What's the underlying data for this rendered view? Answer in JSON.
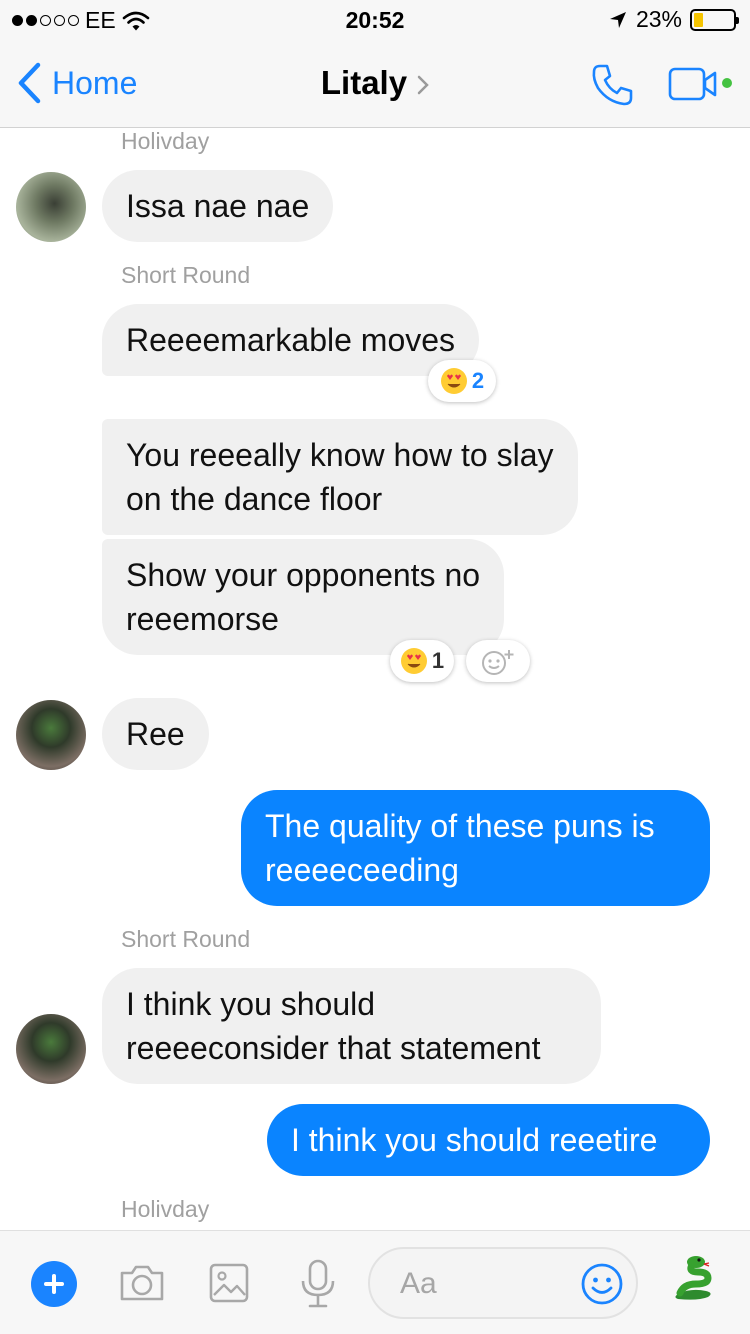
{
  "status_bar": {
    "carrier": "EE",
    "time": "20:52",
    "battery": "23%",
    "battery_level": 0.23
  },
  "nav": {
    "back_label": "Home",
    "title": "Litaly"
  },
  "messages": [
    {
      "sender": "Holivday",
      "text": "Issa nae nae"
    },
    {
      "sender": "Short Round",
      "text": "Reeeemarkable moves",
      "reaction_count": "2"
    },
    {
      "lines": [
        "You reeeally know how to slay",
        "on the dance floor"
      ]
    },
    {
      "lines": [
        "Show your opponents no",
        "reeemorse"
      ],
      "reaction_count": "1"
    },
    {
      "text": "Ree"
    },
    {
      "lines": [
        "The quality of these puns is",
        "reeeeceeding"
      ]
    },
    {
      "sender": "Short Round",
      "lines": [
        "I think you should",
        "reeeeconsider that statement"
      ]
    },
    {
      "text": "I think you should reeetire"
    },
    {
      "sender": "Holivday"
    }
  ],
  "composer": {
    "placeholder": "Aa"
  },
  "colors": {
    "accent": "#1a84ff",
    "outgoing_bubble": "#0a84ff",
    "incoming_bubble": "#f0f0f0",
    "presence_dot": "#44c241"
  },
  "icons": [
    "signal-dots-icon",
    "wifi-icon",
    "location-arrow-icon",
    "battery-icon",
    "back-chevron-icon",
    "title-chevron-icon",
    "phone-icon",
    "video-camera-icon",
    "love-eyes-emoji-icon",
    "add-reaction-icon",
    "plus-icon",
    "camera-icon",
    "image-icon",
    "microphone-icon",
    "smiley-icon",
    "snake-emoji-icon"
  ]
}
